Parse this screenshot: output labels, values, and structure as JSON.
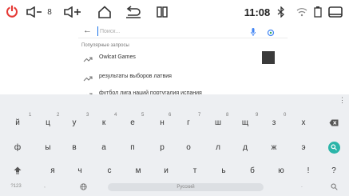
{
  "status_bar": {
    "power_glyph": "⏻",
    "volume_level": "8",
    "time": "11:08",
    "icons": [
      "power-icon",
      "volume-down-icon",
      "volume-up-icon",
      "home-icon",
      "back-icon",
      "recents-icon",
      "bluetooth-icon",
      "wifi-icon",
      "battery-icon",
      "window-icon"
    ]
  },
  "search": {
    "placeholder": "Поиск...",
    "popular_label": "Популярные запросы",
    "suggestions": [
      {
        "text": "Owlcat Games"
      },
      {
        "text": "результаты выборов латвия"
      },
      {
        "text": "футбол лига наций португалия испания"
      }
    ]
  },
  "keyboard": {
    "row1": [
      {
        "key": "й",
        "hint": "1"
      },
      {
        "key": "ц",
        "hint": "2"
      },
      {
        "key": "у",
        "hint": "3"
      },
      {
        "key": "к",
        "hint": "4"
      },
      {
        "key": "е",
        "hint": "5"
      },
      {
        "key": "н",
        "hint": "6"
      },
      {
        "key": "г",
        "hint": "7"
      },
      {
        "key": "ш",
        "hint": "8"
      },
      {
        "key": "щ",
        "hint": "9"
      },
      {
        "key": "з",
        "hint": "0"
      },
      {
        "key": "х",
        "hint": ""
      }
    ],
    "row2": [
      "ф",
      "ы",
      "в",
      "а",
      "п",
      "р",
      "о",
      "л",
      "д",
      "ж",
      "э"
    ],
    "row3": [
      "я",
      "ч",
      "с",
      "м",
      "и",
      "т",
      "ь",
      "б",
      "ю"
    ],
    "row3_extra": [
      "!",
      "?"
    ],
    "symbols_label": "?123",
    "comma": ",",
    "space_label": "Русский",
    "period": ".",
    "colors": {
      "accent": "#2bb5a9",
      "keyboard_bg": "#edeff2",
      "power": "#e53935"
    }
  }
}
